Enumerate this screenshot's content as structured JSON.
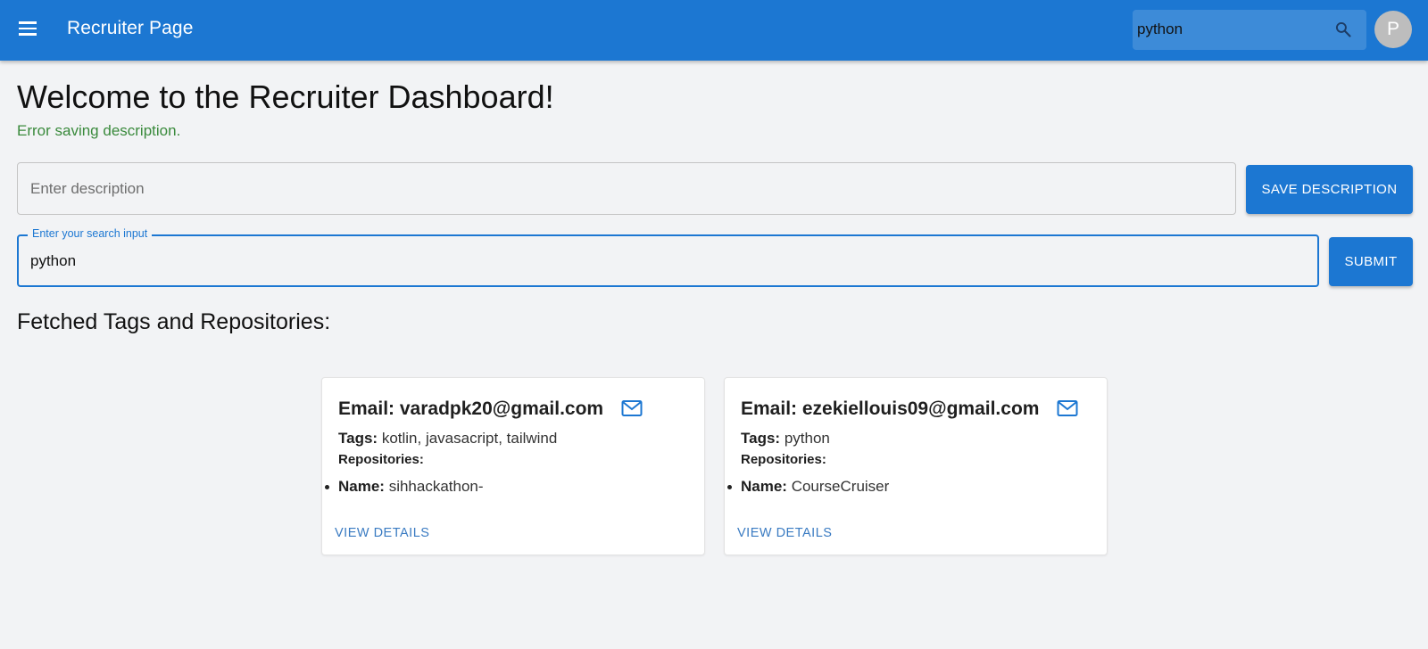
{
  "appbar": {
    "title": "Recruiter Page",
    "search_value": "python",
    "avatar_initial": "P",
    "color": "#1c77d2"
  },
  "main": {
    "heading": "Welcome to the Recruiter Dashboard!",
    "status_message": "Error saving description.",
    "description_placeholder": "Enter description",
    "save_button": "SAVE DESCRIPTION",
    "search_label": "Enter your search input",
    "search_value": "python",
    "submit_button": "SUBMIT",
    "section_heading": "Fetched Tags and Repositories:"
  },
  "cards": [
    {
      "email_label": "Email: varadpk20@gmail.com",
      "tags_label": "Tags:",
      "tags": "kotlin, javasacript, tailwind",
      "repos_label": "Repositories:",
      "repo_name_label": "Name:",
      "repo_name": "sihhackathon-",
      "link": "VIEW DETAILS"
    },
    {
      "email_label": "Email: ezekiellouis09@gmail.com",
      "tags_label": "Tags:",
      "tags": "python",
      "repos_label": "Repositories:",
      "repo_name_label": "Name:",
      "repo_name": "CourseCruiser",
      "link": "VIEW DETAILS"
    }
  ],
  "colors": {
    "primary": "#1c77d2",
    "success_text": "#3a8a3c",
    "background": "#f2f3f5"
  },
  "icons": [
    "menu-icon",
    "search-icon",
    "mail-icon"
  ]
}
